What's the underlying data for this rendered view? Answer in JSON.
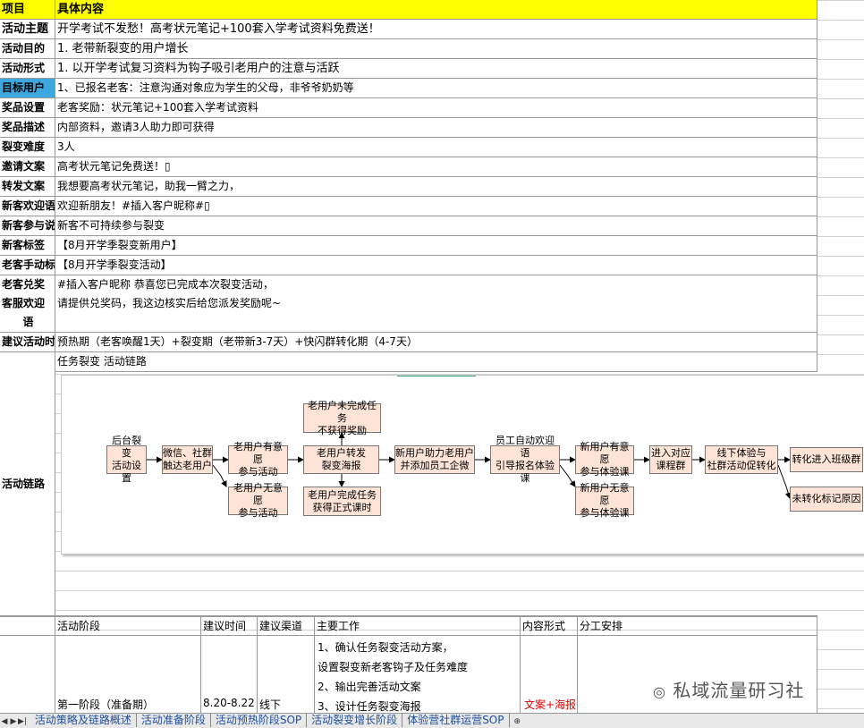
{
  "header": {
    "col_a": "项目",
    "col_b": "具体内容"
  },
  "rows": [
    {
      "label": "活动主题",
      "value": "开学考试不发愁！高考状元笔记+100套入学考试资料免费送！"
    },
    {
      "label": "活动目的",
      "value": "1. 老带新裂变的用户增长"
    },
    {
      "label": "活动形式",
      "value": "1. 以开学考试复习资料为钩子吸引老用户的注意与活跃"
    },
    {
      "label": "目标用户",
      "value": "1、已报名老客：注意沟通对象应为学生的父母，非爷爷奶奶等"
    },
    {
      "label": "奖品设置",
      "value": "老客奖励：状元笔记+100套入学考试资料"
    },
    {
      "label": "奖品描述",
      "value": "内部资料，邀请3人助力即可获得"
    },
    {
      "label": "裂变难度",
      "value": "3人"
    },
    {
      "label": "邀请文案",
      "value": "高考状元笔记免费送！▯"
    },
    {
      "label": "转发文案",
      "value": "我想要高考状元笔记，助我一臂之力，"
    },
    {
      "label": "新客欢迎语",
      "value": " 欢迎新朋友！#插入客户昵称#▯"
    },
    {
      "label": "新客参与说明",
      "value": "新客不可持续参与裂变"
    },
    {
      "label": "新客标签",
      "value": "【8月开学季裂变新用户】"
    },
    {
      "label": "老客手动标签",
      "value": "【8月开学季裂变活动】"
    }
  ],
  "redeem": {
    "label1": "老客兑奖",
    "label2": "客服欢迎",
    "label3": "语",
    "line1": "#插入客户昵称 恭喜您已完成本次裂变活动，",
    "line2": "请提供兑奖码，我这边核实后给您派发奖励呢~"
  },
  "suggest": {
    "label": "建议活动时长",
    "value": "预热期（老客唤醒1天）+裂变期（老带新3-7天）+快闪群转化期（4-7天）"
  },
  "chain": {
    "label": "活动链路",
    "title": "任务裂变 活动链路",
    "boxes": {
      "b1": "后台裂变\n活动设置",
      "b2": "微信、社群\n触达老用户",
      "b3": "老用户有意愿\n参与活动",
      "b4": "老用户无意愿\n参与活动",
      "b5": "老用户未完成任务\n不获得奖励",
      "b6": "老用户转发\n裂变海报",
      "b7": "老用户完成任务\n获得正式课时",
      "b8": "新用户助力老用户\n并添加员工企微",
      "b9": "员工自动欢迎语\n引导报名体验课",
      "b10": "新用户有意愿\n参与体验课",
      "b11": "新用户无意愿\n参与体验课",
      "b12": "进入对应\n课程群",
      "b13": "线下体验与\n社群活动促转化",
      "b14": "转化进入班级群",
      "b15": "未转化标记原因"
    }
  },
  "subtable": {
    "headers": [
      "活动阶段",
      "建议时间",
      "建议渠道",
      "主要工作",
      "内容形式",
      "分工安排"
    ],
    "stage": "第一阶段（准备期）",
    "time": "8.20-8.22",
    "channel": "线下",
    "work": [
      "1、确认任务裂变活动方案，",
      "设置裂变新老客钩子及任务难度",
      "2、输出完善活动文案",
      "3、设计任务裂变海报"
    ],
    "content_form": "文案+海报",
    "content_color": "#e00000"
  },
  "tabs": [
    "活动策略及链路概述",
    "活动准备阶段",
    "活动预热阶段SOP",
    "活动裂变增长阶段",
    "体验营社群运营SOP"
  ],
  "watermark": "私域流量研习社",
  "colors": {
    "header": "#ffff00",
    "highlight": "#3fa7e0",
    "box_fill": "#fde4d6"
  }
}
